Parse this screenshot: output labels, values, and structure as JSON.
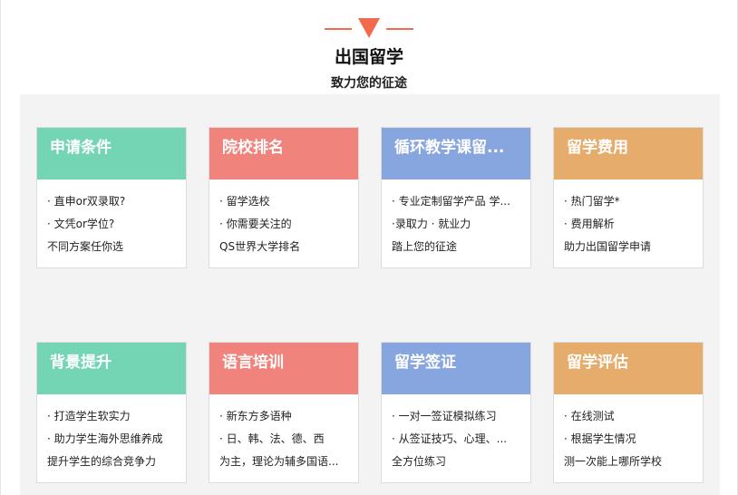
{
  "header": {
    "title": "出国留学",
    "subtitle": "致力您的征途"
  },
  "colors": {
    "accent": "#f26a4b",
    "green": "#74d5b4",
    "red": "#f0837c",
    "blue": "#87a6df",
    "orange": "#e6ac6b"
  },
  "cards": [
    {
      "title": "申请条件",
      "lines": [
        "· 直申or双录取?",
        "· 文凭or学位?",
        "不同方案任你选"
      ]
    },
    {
      "title": "院校排名",
      "lines": [
        "· 留学选校",
        "· 你需要关注的",
        "QS世界大学排名"
      ]
    },
    {
      "title": "循环教学课留...",
      "lines": [
        "· 专业定制留学产品 学...",
        "·录取力 · 就业力",
        "踏上您的征途"
      ]
    },
    {
      "title": "留学费用",
      "lines": [
        "· 热门留学*",
        "· 费用解析",
        "助力出国留学申请"
      ]
    },
    {
      "title": "背景提升",
      "lines": [
        "· 打造学生软实力",
        "· 助力学生海外思维养成",
        "提升学生的综合竞争力"
      ]
    },
    {
      "title": "语言培训",
      "lines": [
        "· 新东方多语种",
        "· 日、韩、法、德、西",
        "为主，理论为辅多国语..."
      ]
    },
    {
      "title": "留学签证",
      "lines": [
        "· 一对一签证模拟练习",
        "· 从签证技巧、心理、...",
        "全方位练习"
      ]
    },
    {
      "title": "留学评估",
      "lines": [
        "· 在线测试",
        "· 根据学生情况",
        "测一次能上哪所学校"
      ]
    }
  ]
}
